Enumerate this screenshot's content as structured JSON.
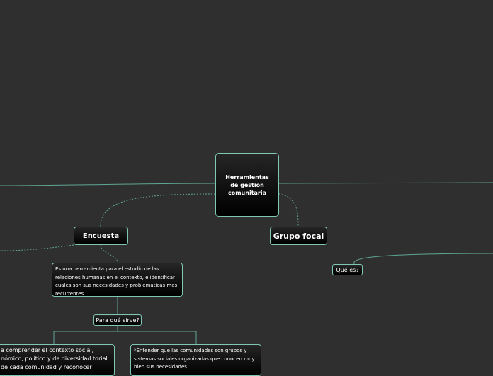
{
  "map": {
    "center": {
      "label": "Herramientas de gestion comunitaria"
    },
    "encuesta": {
      "label": "Encuesta"
    },
    "grupo_focal": {
      "label": "Grupo focal"
    },
    "que_es": {
      "label": "Qué es?"
    },
    "es_definicion": {
      "label": "Es una herramienta para el estudio de las relaciones humanas en el contexto, e identificar cuales son sus necesidades y problematicas mas recurrentes."
    },
    "para_que_sirve": {
      "label": "Para qué sirve?"
    },
    "comprender": {
      "label": "a comprender el contexto social, nómico, político y de diversidad torial de cada comunidad y reconocer"
    },
    "entender": {
      "label": "*Entender que las comunidades son grupos y sistemas sociales organizadas que conocen muy bien sus necesidades."
    }
  },
  "colors": {
    "background": "#2f2f2f",
    "connector": "#5fa594",
    "node_border": "#7fc7b5"
  }
}
